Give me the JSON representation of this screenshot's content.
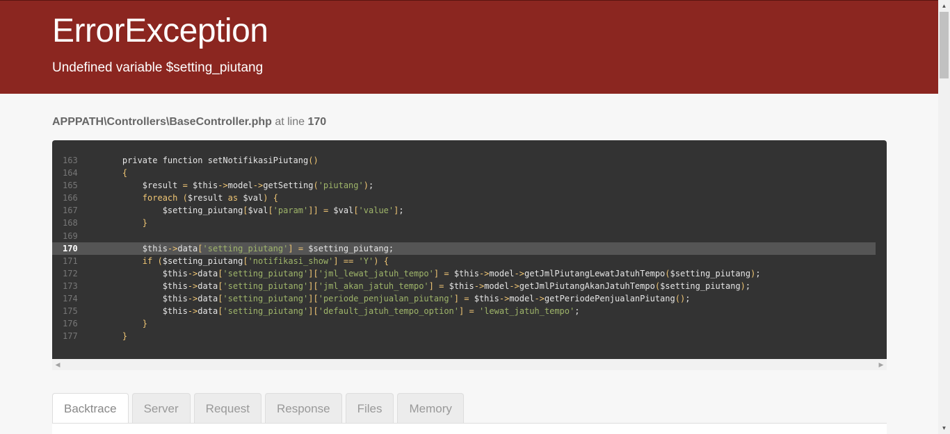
{
  "header": {
    "title": "ErrorException",
    "message": "Undefined variable $setting_piutang"
  },
  "source": {
    "path": "APPPATH\\Controllers\\BaseController.php",
    "at_line_text": " at line ",
    "line": "170"
  },
  "code_lines": [
    {
      "num": "163",
      "code": "    private function setNotifikasiPiutang()"
    },
    {
      "num": "164",
      "code": "    {"
    },
    {
      "num": "165",
      "code": "        $result = $this->model->getSetting('piutang');"
    },
    {
      "num": "166",
      "code": "        foreach ($result as $val) {"
    },
    {
      "num": "167",
      "code": "            $setting_piutang[$val['param']] = $val['value'];"
    },
    {
      "num": "168",
      "code": "        }"
    },
    {
      "num": "169",
      "code": ""
    },
    {
      "num": "170",
      "code": "        $this->data['setting_piutang'] = $setting_piutang;",
      "highlight": true
    },
    {
      "num": "171",
      "code": "        if ($setting_piutang['notifikasi_show'] == 'Y') {"
    },
    {
      "num": "172",
      "code": "            $this->data['setting_piutang']['jml_lewat_jatuh_tempo'] = $this->model->getJmlPiutangLewatJatuhTempo($setting_piutang);"
    },
    {
      "num": "173",
      "code": "            $this->data['setting_piutang']['jml_akan_jatuh_tempo'] = $this->model->getJmlPiutangAkanJatuhTempo($setting_piutang);"
    },
    {
      "num": "174",
      "code": "            $this->data['setting_piutang']['periode_penjualan_piutang'] = $this->model->getPeriodePenjualanPiutang();"
    },
    {
      "num": "175",
      "code": "            $this->data['setting_piutang']['default_jatuh_tempo_option'] = 'lewat_jatuh_tempo';"
    },
    {
      "num": "176",
      "code": "        }"
    },
    {
      "num": "177",
      "code": "    }"
    }
  ],
  "tabs": [
    {
      "label": "Backtrace",
      "active": true
    },
    {
      "label": "Server"
    },
    {
      "label": "Request"
    },
    {
      "label": "Response"
    },
    {
      "label": "Files"
    },
    {
      "label": "Memory"
    }
  ],
  "icons": {
    "scroll_left": "chevron-left-icon",
    "scroll_right": "chevron-right-icon",
    "scroll_up": "chevron-up-icon",
    "scroll_down": "chevron-down-icon"
  },
  "colors": {
    "header_bg": "#8b2620",
    "code_bg": "#333333",
    "highlight_bg": "#555555"
  }
}
